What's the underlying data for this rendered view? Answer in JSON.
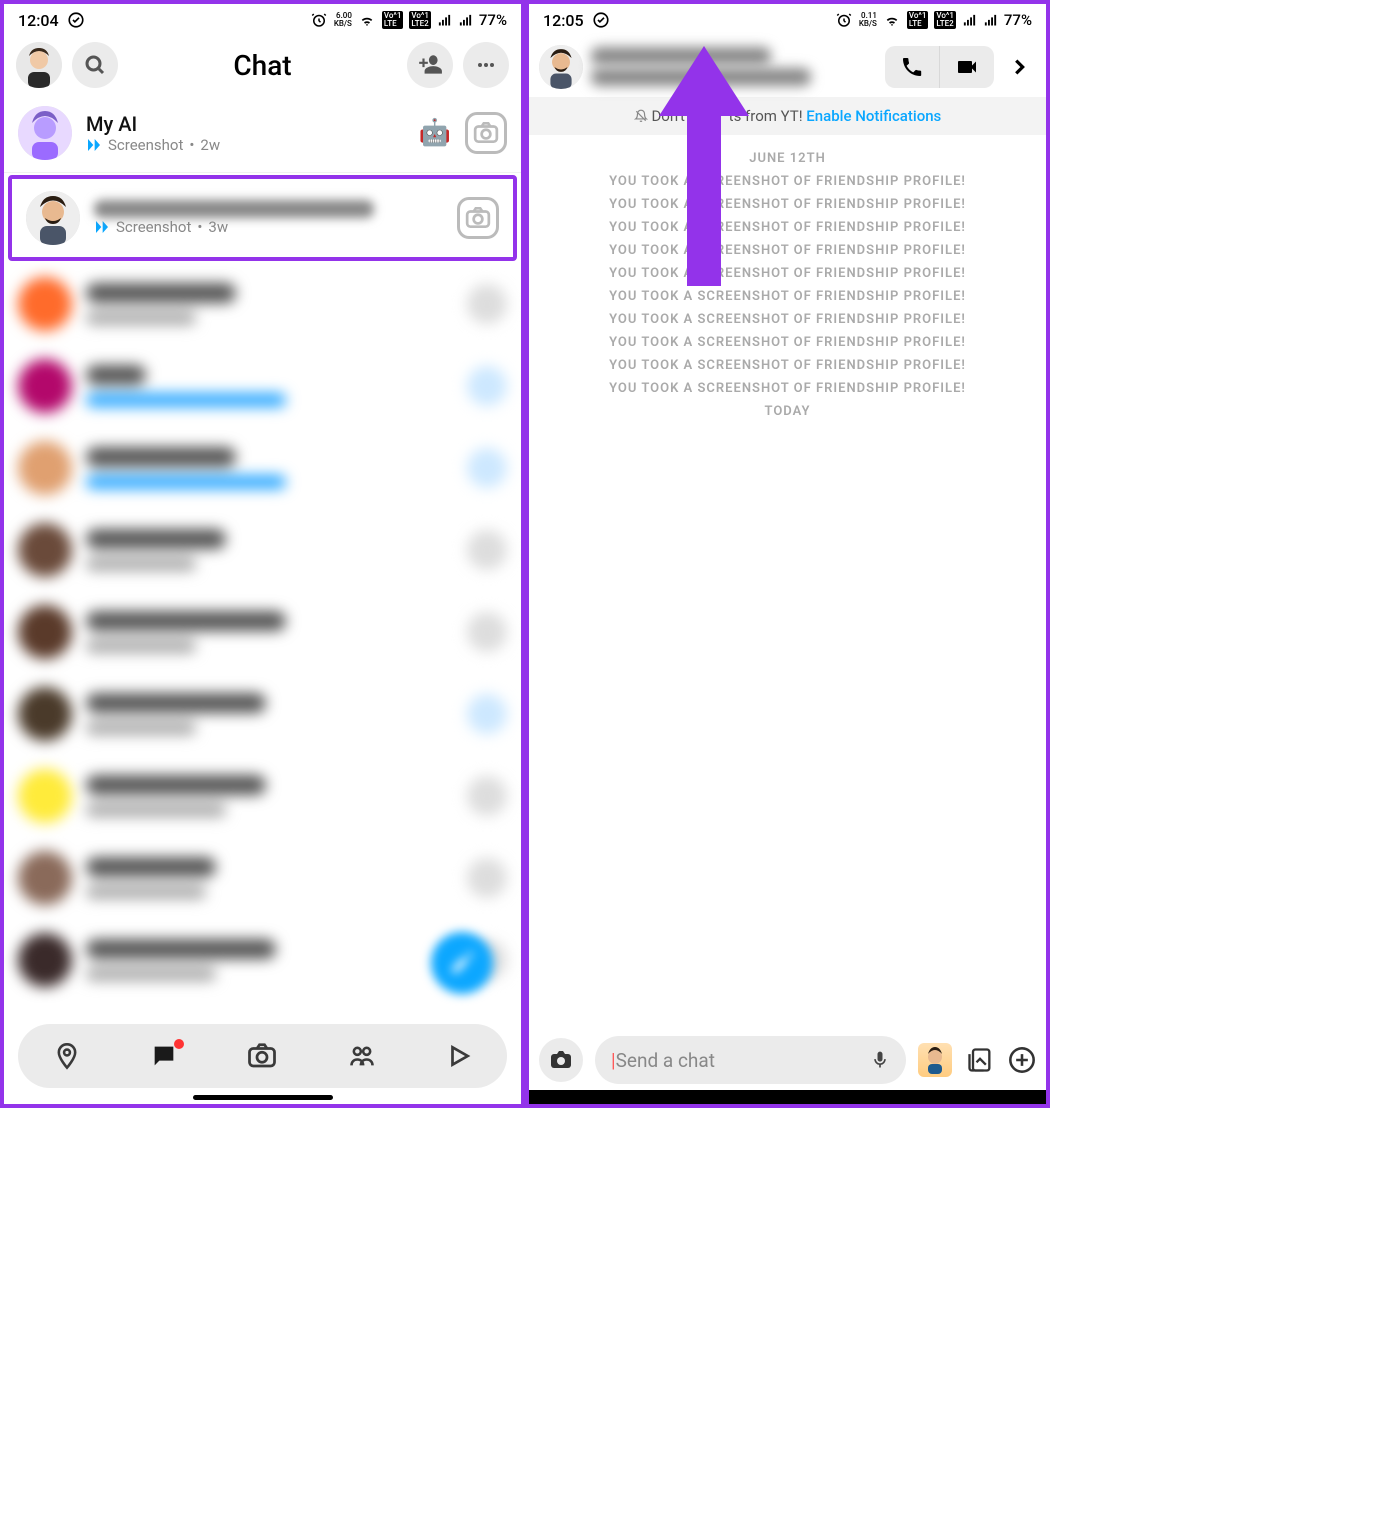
{
  "status": {
    "left_time_a": "12:04",
    "left_time_b": "12:05",
    "kbs_a": "6.00",
    "kbs_b": "0.11",
    "kbs_unit": "KB/S",
    "lte1": "Vo1\nLTE",
    "lte2": "Vo1\nLTE2",
    "battery": "77%"
  },
  "chatlist": {
    "title": "Chat",
    "rows": [
      {
        "name": "My AI",
        "sub": "Screenshot",
        "time": "2w"
      },
      {
        "name": "",
        "sub": "Screenshot",
        "time": "3w"
      }
    ]
  },
  "notif": {
    "prefix": "Don't mi",
    "suffix": "ts from YT! ",
    "link": "Enable Notifications"
  },
  "log": {
    "date": "JUNE 12TH",
    "line": "YOU TOOK A SCREENSHOT OF FRIENDSHIP PROFILE!",
    "today": "TODAY"
  },
  "input": {
    "placeholder": "Send a chat"
  }
}
